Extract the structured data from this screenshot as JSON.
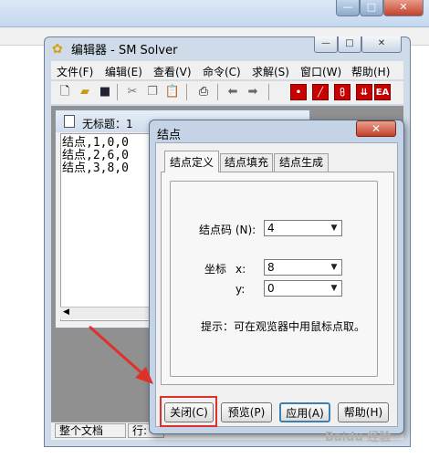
{
  "background_window": {
    "min": "—",
    "max": "□",
    "close": "✕"
  },
  "editor": {
    "title": "编辑器 - SM Solver",
    "controls": {
      "min": "—",
      "max": "□",
      "close": "✕"
    },
    "menu": [
      "文件(F)",
      "编辑(E)",
      "查看(V)",
      "命令(C)",
      "求解(S)",
      "窗口(W)",
      "帮助(H)"
    ],
    "toolbar_icons": [
      "new-file-icon",
      "open-folder-icon",
      "save-icon",
      "cut-icon",
      "copy-icon",
      "paste-icon",
      "print-icon",
      "arrow-left-icon",
      "arrow-right-icon",
      "node-tool-icon",
      "line-tool-icon",
      "support-tool-icon",
      "load-tool-icon",
      "ea-tool-icon"
    ],
    "toolbar_ea_label": "EA",
    "document": {
      "title": "无标题：1",
      "lines": [
        "结点,1,0,0",
        "结点,2,6,0",
        "结点,3,8,0"
      ]
    },
    "status": {
      "scope": "整个文档",
      "row": "行:"
    }
  },
  "dialog": {
    "title": "结点",
    "close": "✕",
    "tabs": [
      "结点定义",
      "结点填充",
      "结点生成"
    ],
    "active_tab": 0,
    "node_code_label": "结点码 (N):",
    "node_code_value": "4",
    "coord_label": "坐标",
    "x_label": "x:",
    "x_value": "8",
    "y_label": "y:",
    "y_value": "0",
    "hint": "提示：可在观览器中用鼠标点取。",
    "buttons": {
      "close": "关闭(C)",
      "preview": "预览(P)",
      "apply": "应用(A)",
      "help": "帮助(H)"
    }
  },
  "colors": {
    "highlight": "#e0302a",
    "arrow": "#e0302a"
  },
  "watermark": "Baidu 经验"
}
